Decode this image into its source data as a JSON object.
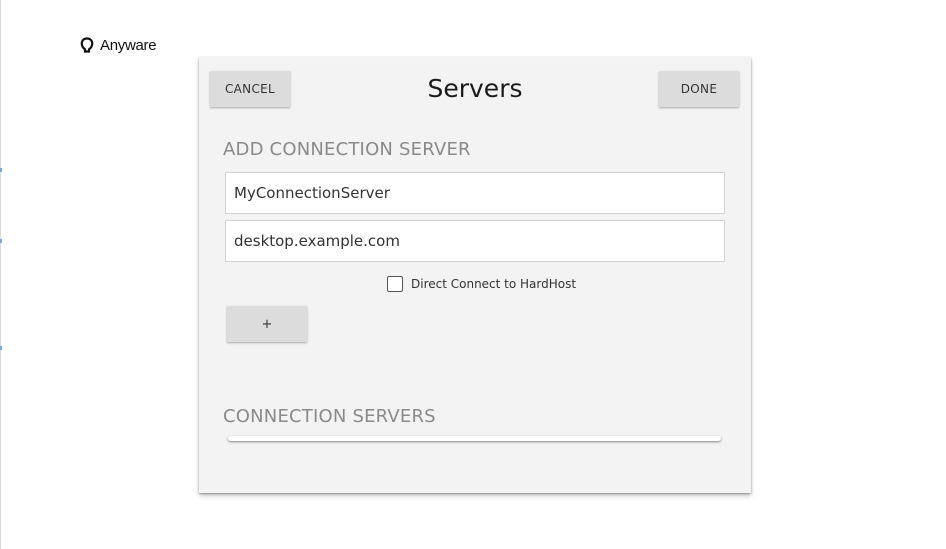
{
  "brand": {
    "logo_icon": "anyware-logo-icon",
    "name": "Anyware"
  },
  "dialog": {
    "title": "Servers",
    "cancel_label": "CANCEL",
    "done_label": "DONE",
    "add_section": {
      "heading": "ADD CONNECTION SERVER",
      "name_input": {
        "value": "MyConnectionServer",
        "placeholder": ""
      },
      "address_input": {
        "value": "desktop.example.com",
        "placeholder": ""
      },
      "direct_connect": {
        "label": "Direct Connect to HardHost",
        "checked": false
      },
      "add_label": "+"
    },
    "list_section": {
      "heading": "CONNECTION SERVERS",
      "items": []
    }
  },
  "colors": {
    "dialog_bg": "#f3f3f3",
    "button_bg": "#dcdcdc",
    "heading_text": "#8a8a8a",
    "accent_mark": "#7fa7d6"
  }
}
